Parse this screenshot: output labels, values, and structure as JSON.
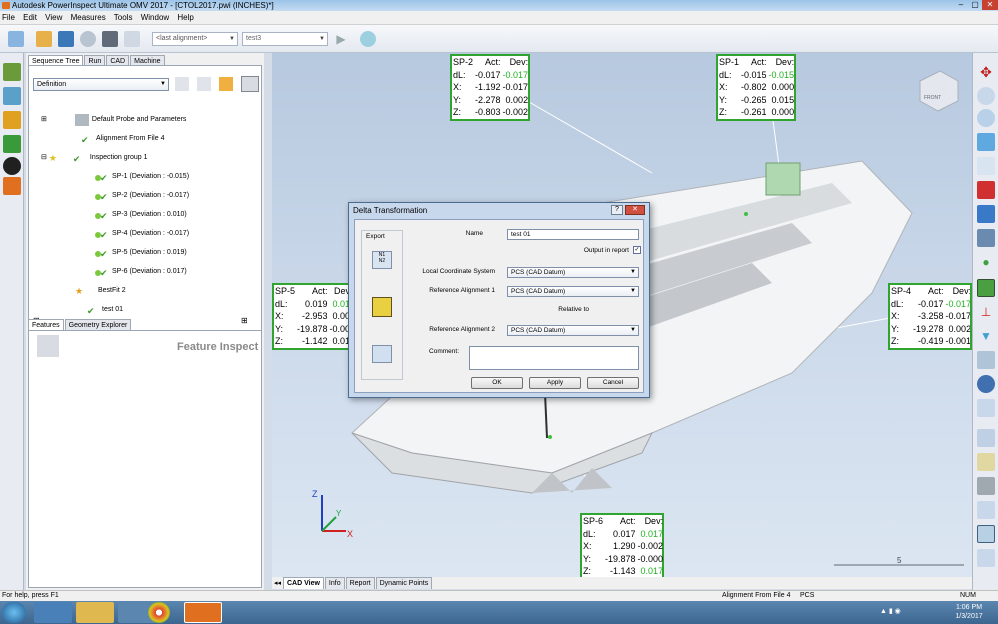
{
  "app": {
    "title": "Autodesk PowerInspect Ultimate OMV 2017 - [CTOL2017.pwi (INCHES)*]"
  },
  "menu": [
    "File",
    "Edit",
    "View",
    "Measures",
    "Tools",
    "Window",
    "Help"
  ],
  "toolbar": {
    "alignment_placeholder": "<last alignment>",
    "alignment_value": "test3"
  },
  "left_tabs": [
    "Sequence Tree",
    "Run",
    "CAD",
    "Machine"
  ],
  "definition_combo": "Definition",
  "tree": [
    "Default Probe and Parameters",
    "Alignment From File 4",
    "Inspection group 1",
    "SP-1 (Deviation : -0.015)",
    "SP-2 (Deviation : -0.017)",
    "SP-3 (Deviation : 0.010)",
    "SP-4 (Deviation : -0.017)",
    "SP-5 (Deviation : 0.019)",
    "SP-6 (Deviation : 0.017)",
    "BestFit 2",
    "test 01"
  ],
  "feature_tabs": [
    "Features",
    "Geometry Explorer"
  ],
  "feature_inspect_label": "Feature Inspect",
  "sp_boxes": {
    "sp2": {
      "name": "SP-2",
      "act": "Act:",
      "dev": "Dev:",
      "rows": [
        [
          "dL:",
          "-0.017",
          "-0.017"
        ],
        [
          "X:",
          "-1.192",
          "-0.017"
        ],
        [
          "Y:",
          "-2.278",
          "0.002"
        ],
        [
          "Z:",
          "-0.803",
          "-0.002"
        ]
      ]
    },
    "sp1": {
      "name": "SP-1",
      "act": "Act:",
      "dev": "Dev:",
      "rows": [
        [
          "dL:",
          "-0.015",
          "-0.015"
        ],
        [
          "X:",
          "-0.802",
          "0.000"
        ],
        [
          "Y:",
          "-0.265",
          "0.015"
        ],
        [
          "Z:",
          "-0.261",
          "0.000"
        ]
      ]
    },
    "sp5": {
      "name": "SP-5",
      "act": "Act:",
      "dev": "Dev",
      "rows": [
        [
          "dL:",
          "0.019",
          "0.01"
        ],
        [
          "X:",
          "-2.953",
          "0.00"
        ],
        [
          "Y:",
          "-19.878",
          "-0.00"
        ],
        [
          "Z:",
          "-1.142",
          "0.01"
        ]
      ]
    },
    "sp4": {
      "name": "SP-4",
      "act": "Act:",
      "dev": "Dev:",
      "rows": [
        [
          "dL:",
          "-0.017",
          "-0.017"
        ],
        [
          "X:",
          "-3.258",
          "-0.017"
        ],
        [
          "Y:",
          "-19.278",
          "0.002"
        ],
        [
          "Z:",
          "-0.419",
          "-0.001"
        ]
      ]
    },
    "sp6": {
      "name": "SP-6",
      "act": "Act:",
      "dev": "Dev:",
      "rows": [
        [
          "dL:",
          "0.017",
          "0.017"
        ],
        [
          "X:",
          "1.290",
          "-0.002"
        ],
        [
          "Y:",
          "-19.878",
          "-0.000"
        ],
        [
          "Z:",
          "-1.143",
          "0.017"
        ]
      ]
    }
  },
  "dialog": {
    "title": "Delta Transformation",
    "export_label": "Export",
    "name_label": "Name",
    "name_value": "test 01",
    "output_in_report": "Output in report",
    "lcs_label": "Local Coordinate System",
    "lcs_value": "PCS (CAD Datum)",
    "ref1_label": "Reference Alignment 1",
    "ref1_value": "PCS (CAD Datum)",
    "relative_to": "Relative to",
    "ref2_label": "Reference Alignment 2",
    "ref2_value": "PCS (CAD Datum)",
    "comment_label": "Comment:",
    "ok": "OK",
    "apply": "Apply",
    "cancel": "Cancel"
  },
  "viewport_tabs": [
    "CAD View",
    "Info",
    "Report",
    "Dynamic Points"
  ],
  "scale_label": "5",
  "viewcube_label": "FRONT",
  "status": {
    "help": "For help, press F1",
    "alignment": "Alignment From File 4",
    "pcs": "PCS",
    "num": "NUM"
  },
  "clock": {
    "time": "1:06 PM",
    "date": "1/3/2017"
  }
}
